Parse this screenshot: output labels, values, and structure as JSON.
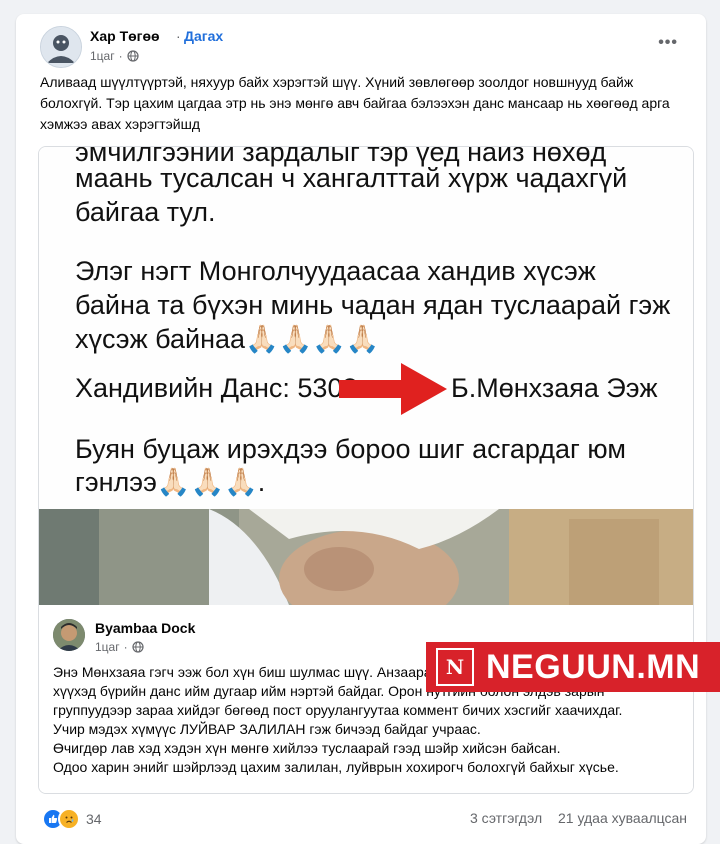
{
  "post": {
    "author": "Хар Төгөө",
    "separator": "·",
    "follow_label": "Дагах",
    "time": "1цаг",
    "audience_icon": "globe-icon",
    "more_icon": "more-horizontal-icon",
    "caption": "Аливаад шүүлтүүртэй, няхуур байх хэрэгтэй шүү. Хүний зөвлөгөөр зоолдог новшнууд байж болохгүй. Тэр цахим цагдаа этр нь энэ мөнгө авч байгаа бэлээхэн данс мансаар нь хөөгөөд арга хэмжээ авах хэрэгтэйшд"
  },
  "shared_image": {
    "line1": "эмчилгээний зардалыг тэр үед найз нөхөд",
    "line2": "маань тусалсан ч  хангалттай хүрж чадахгүй",
    "line3": "байгаа тул.",
    "line4": "Элэг нэгт Монголчуудаасаа хандив хүсэж",
    "line5": "байна та бүхэн минь чадан ядан туслаарай гэж",
    "line6": "хүсэж байнаа🙏🏻🙏🏻🙏🏻🙏🏻",
    "line7_prefix": "Хандивийн Данс: 5308",
    "line7_suffix": "Б.Мөнхзаяа Ээж",
    "line8": "Буян буцаж ирэхдээ бороо шиг асгардаг юм",
    "line9": "гэнлээ🙏🏻🙏🏻🙏🏻.",
    "arrow_color": "#e0211f"
  },
  "shared_post": {
    "author": "Byambaa Dock",
    "time": "1цаг",
    "audience_icon": "globe-icon",
    "p1": "Энэ Мөнхзаяа гэгч ээж бол хүн биш шулмас шүү. Анзаараад байхад олон жилийн өмнөөс хүүхэд бүрийн данс ийм дугаар ийм нэртэй байдаг. Орон нутгийн болон элдэв зарын группуудээр зараа хийдэг бөгөөд пост оруулангуутаа коммент бичих хэсгийг хаачихдаг.",
    "p2": "Учир мэдэх хүмүүс ЛУЙВАР ЗАЛИЛАН гэж бичээд байдаг учраас.",
    "p3": "Өчигдөр лав хэд хэдэн хүн мөнгө хийлээ туслаарай гээд шэйр хийсэн байсан.",
    "p4": "Одоо харин энийг шэйрлээд цахим залилан, луйврын хохирогч болохгүй байхыг хүсье."
  },
  "footer": {
    "reaction_icons": [
      "like-icon",
      "sad-icon"
    ],
    "reaction_count": "34",
    "comments": "3 сэтгэгдэл",
    "shares": "21 удаа хуваалцсан"
  },
  "watermark": {
    "logo_letter": "N",
    "text": "NEGUUN.MN",
    "color": "#d8222a"
  }
}
